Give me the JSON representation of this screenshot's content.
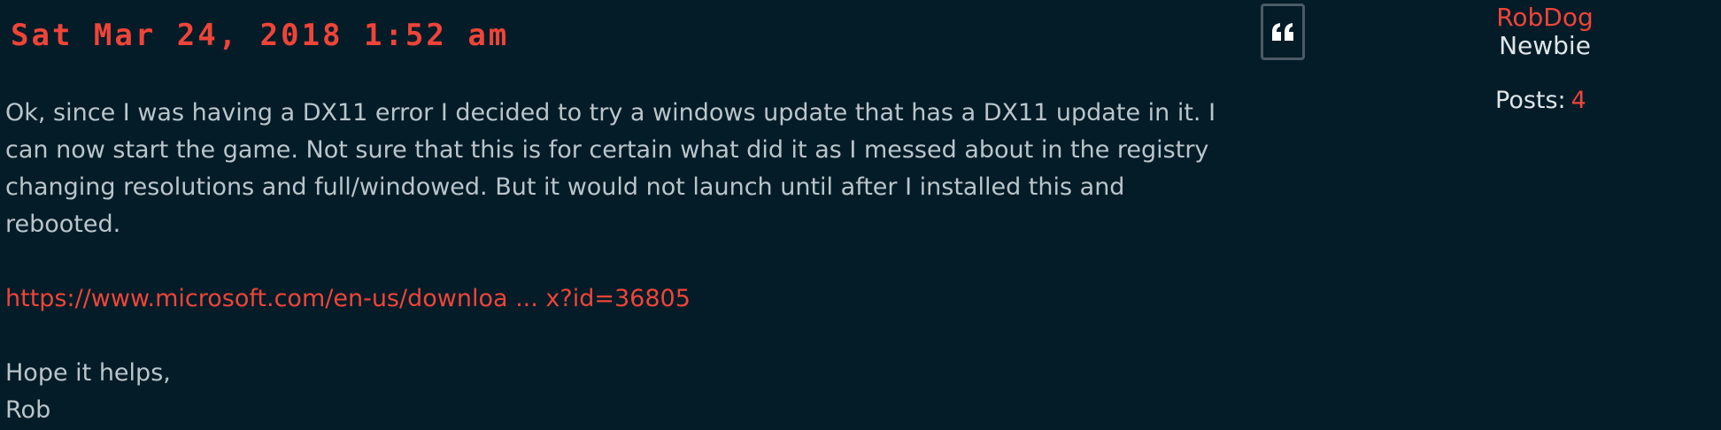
{
  "post": {
    "date": "Sat Mar 24, 2018 1:52 am",
    "quote_icon": "quote-icon",
    "body": {
      "paragraph_1_lines": [
        "Ok, since I was having a DX11 error I decided to try a windows update that has a DX11 update in it. I",
        "can now start the game. Not sure that this is for certain what did it as I messed about in the registry",
        "changing resolutions and full/windowed. But it would not launch until after I installed this and",
        "rebooted."
      ],
      "link_text": "https://www.microsoft.com/en-us/downloa ... x?id=36805",
      "closing": "Hope it helps,",
      "signature": "Rob"
    }
  },
  "author": {
    "username": "RobDog",
    "rank": "Newbie",
    "posts_label": "Posts:",
    "posts_count": "4"
  },
  "colors": {
    "background": "#031c28",
    "accent": "#f04438",
    "text": "#bac5cb",
    "text_light": "#dfe6ea",
    "border": "#4a5b66"
  }
}
